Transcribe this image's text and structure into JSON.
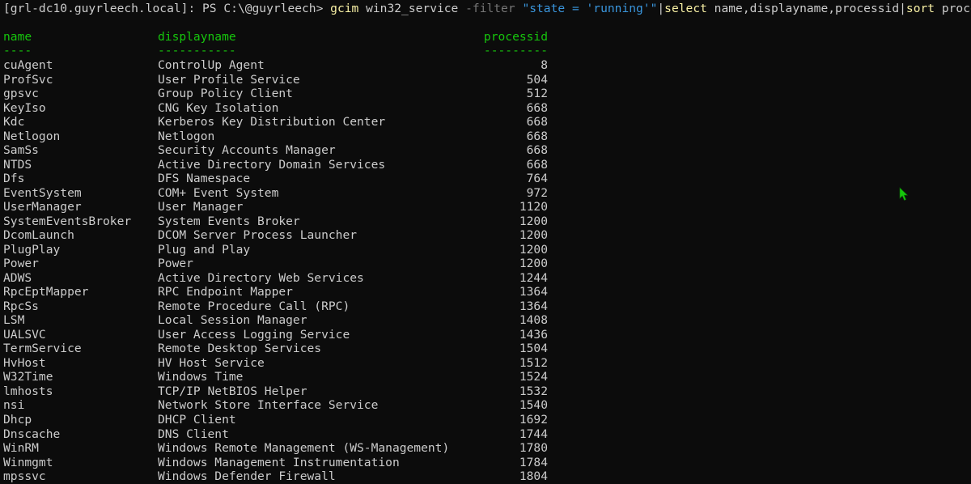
{
  "terminal": {
    "prompt": {
      "prefix": "[grl-dc10.guyrleech.local]: PS C:\\@guyrleech> ",
      "cmd1": "gcim",
      "t1": " win32_service ",
      "param": "-filter",
      "t2": " ",
      "str": "\"state = 'running'\"",
      "pipe1": "|",
      "cmd2": "select",
      "t3": " name,displayname,processid",
      "pipe2": "|",
      "cmd3": "sort",
      "t4": " processid"
    },
    "headers": {
      "name": "name",
      "displayname": "displayname",
      "processid": "processid",
      "name_sep": "----",
      "displayname_sep": "-----------",
      "processid_sep": "---------"
    },
    "rows": [
      {
        "name": "cuAgent",
        "displayname": "ControlUp Agent",
        "processid": "8"
      },
      {
        "name": "ProfSvc",
        "displayname": "User Profile Service",
        "processid": "504"
      },
      {
        "name": "gpsvc",
        "displayname": "Group Policy Client",
        "processid": "512"
      },
      {
        "name": "KeyIso",
        "displayname": "CNG Key Isolation",
        "processid": "668"
      },
      {
        "name": "Kdc",
        "displayname": "Kerberos Key Distribution Center",
        "processid": "668"
      },
      {
        "name": "Netlogon",
        "displayname": "Netlogon",
        "processid": "668"
      },
      {
        "name": "SamSs",
        "displayname": "Security Accounts Manager",
        "processid": "668"
      },
      {
        "name": "NTDS",
        "displayname": "Active Directory Domain Services",
        "processid": "668"
      },
      {
        "name": "Dfs",
        "displayname": "DFS Namespace",
        "processid": "764"
      },
      {
        "name": "EventSystem",
        "displayname": "COM+ Event System",
        "processid": "972"
      },
      {
        "name": "UserManager",
        "displayname": "User Manager",
        "processid": "1120"
      },
      {
        "name": "SystemEventsBroker",
        "displayname": "System Events Broker",
        "processid": "1200"
      },
      {
        "name": "DcomLaunch",
        "displayname": "DCOM Server Process Launcher",
        "processid": "1200"
      },
      {
        "name": "PlugPlay",
        "displayname": "Plug and Play",
        "processid": "1200"
      },
      {
        "name": "Power",
        "displayname": "Power",
        "processid": "1200"
      },
      {
        "name": "ADWS",
        "displayname": "Active Directory Web Services",
        "processid": "1244"
      },
      {
        "name": "RpcEptMapper",
        "displayname": "RPC Endpoint Mapper",
        "processid": "1364"
      },
      {
        "name": "RpcSs",
        "displayname": "Remote Procedure Call (RPC)",
        "processid": "1364"
      },
      {
        "name": "LSM",
        "displayname": "Local Session Manager",
        "processid": "1408"
      },
      {
        "name": "UALSVC",
        "displayname": "User Access Logging Service",
        "processid": "1436"
      },
      {
        "name": "TermService",
        "displayname": "Remote Desktop Services",
        "processid": "1504"
      },
      {
        "name": "HvHost",
        "displayname": "HV Host Service",
        "processid": "1512"
      },
      {
        "name": "W32Time",
        "displayname": "Windows Time",
        "processid": "1524"
      },
      {
        "name": "lmhosts",
        "displayname": "TCP/IP NetBIOS Helper",
        "processid": "1532"
      },
      {
        "name": "nsi",
        "displayname": "Network Store Interface Service",
        "processid": "1540"
      },
      {
        "name": "Dhcp",
        "displayname": "DHCP Client",
        "processid": "1692"
      },
      {
        "name": "Dnscache",
        "displayname": "DNS Client",
        "processid": "1744"
      },
      {
        "name": "WinRM",
        "displayname": "Windows Remote Management (WS-Management)",
        "processid": "1780"
      },
      {
        "name": "Winmgmt",
        "displayname": "Windows Management Instrumentation",
        "processid": "1784"
      },
      {
        "name": "mpssvc",
        "displayname": "Windows Defender Firewall",
        "processid": "1804"
      }
    ],
    "cursor_icon": "mouse-pointer-icon",
    "cursor_color": "#16c60c"
  }
}
